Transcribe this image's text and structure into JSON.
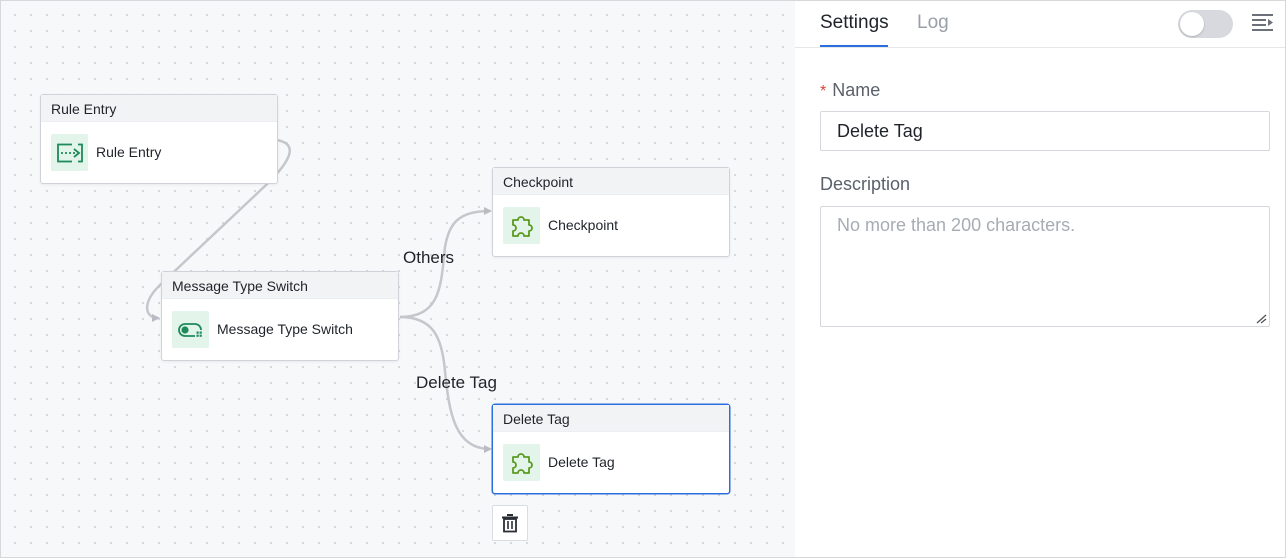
{
  "canvas": {
    "nodes": [
      {
        "id": "rule-entry",
        "title": "Rule Entry",
        "label": "Rule Entry",
        "icon": "rule-entry-icon"
      },
      {
        "id": "message-type-switch",
        "title": "Message Type Switch",
        "label": "Message Type Switch",
        "icon": "switch-toggle-icon"
      },
      {
        "id": "checkpoint",
        "title": "Checkpoint",
        "label": "Checkpoint",
        "icon": "puzzle-icon"
      },
      {
        "id": "delete-tag",
        "title": "Delete Tag",
        "label": "Delete Tag",
        "icon": "puzzle-icon",
        "selected": true
      }
    ],
    "edge_labels": {
      "others": "Others",
      "delete_tag": "Delete Tag"
    },
    "delete_button_icon": "trash-icon"
  },
  "panel": {
    "tabs": [
      {
        "label": "Settings",
        "active": true
      },
      {
        "label": "Log",
        "active": false
      }
    ],
    "toggle": {
      "on": false
    },
    "menu_icon": "collapse-menu-icon",
    "name_field": {
      "label": "Name",
      "required_mark": "*",
      "value": "Delete Tag"
    },
    "description_field": {
      "label": "Description",
      "placeholder": "No more than 200 characters.",
      "value": ""
    }
  },
  "colors": {
    "accent": "#2b6fde",
    "icon_green": "#1d8a5b",
    "puzzle_green": "#5a9a1f",
    "required_red": "#d6453d"
  }
}
